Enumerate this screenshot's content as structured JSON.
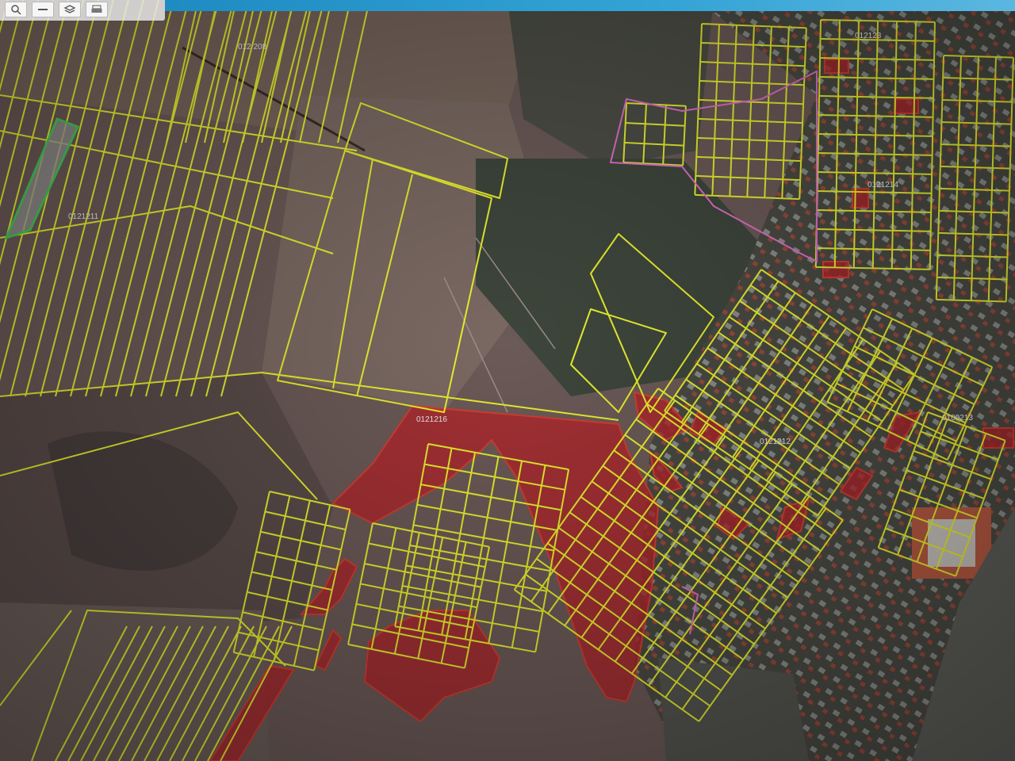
{
  "map": {
    "parcel_line_color": "#e8ef2e",
    "highlight_fill": "#b4242a",
    "highlight_stroke": "#d43d32",
    "boundary_color": "#e070c8",
    "selected_parcel_color": "#49c85a",
    "sector_labels": [
      {
        "id": "s208",
        "text": "012 208"
      },
      {
        "id": "s211",
        "text": "0121211"
      },
      {
        "id": "s213",
        "text": "012123"
      },
      {
        "id": "s214",
        "text": "0121214"
      },
      {
        "id": "s216",
        "text": "0121216"
      },
      {
        "id": "s212",
        "text": "0121212"
      },
      {
        "id": "s0213",
        "text": "0100213"
      }
    ]
  },
  "toolbar": {
    "buttons": [
      {
        "icon": "zoom-in-icon"
      },
      {
        "icon": "zoom-out-icon"
      },
      {
        "icon": "layers-icon"
      },
      {
        "icon": "print-icon"
      }
    ]
  }
}
